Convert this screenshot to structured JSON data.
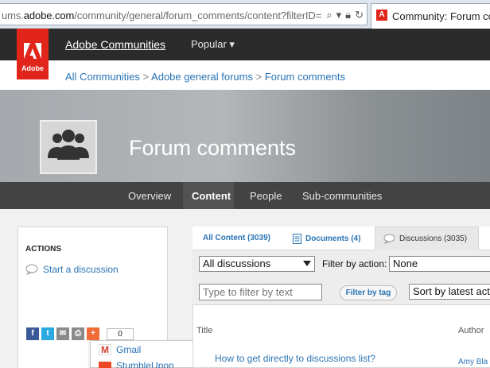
{
  "browser": {
    "url_prefix": "ums.",
    "url_domain": "adobe.com",
    "url_rest": "/community/general/forum_comments/content?filterID=",
    "tab_title": "Community: Forum com",
    "favicon_letter": "A"
  },
  "topnav": {
    "logo_text": "Adobe",
    "home_label": "Adobe Communities",
    "popular_label": "Popular ▾"
  },
  "breadcrumb": {
    "items": [
      "All Communities",
      "Adobe general forums",
      "Forum comments"
    ],
    "separator": ">"
  },
  "hero": {
    "title": "Forum comments"
  },
  "subnav": {
    "items": [
      "Overview",
      "Content",
      "People",
      "Sub-communities"
    ],
    "active": "Content"
  },
  "actions": {
    "title": "ACTIONS",
    "start_discussion": "Start a discussion",
    "share_count": "0",
    "share_buttons": [
      "facebook-icon",
      "twitter-icon",
      "email-icon",
      "print-icon",
      "share-plus-icon"
    ],
    "popup_items": [
      "Gmail",
      "StumbleUpon"
    ]
  },
  "content_tabs": [
    {
      "label": "All Content (3039)",
      "icon": ""
    },
    {
      "label": "Documents (4)",
      "icon": "document-icon"
    },
    {
      "label": "Discussions (3035)",
      "icon": "discussion-icon"
    }
  ],
  "filters": {
    "type_select": "All discussions",
    "filter_label": "Filter by action:",
    "action_select": "None",
    "text_placeholder": "Type to filter by text",
    "tag_button": "Filter by tag",
    "sort_select": "Sort by latest acti"
  },
  "table": {
    "columns": [
      "Title",
      "Author"
    ],
    "rows": [
      {
        "title": "How to get directly to discussions list?",
        "author": "Amy Bla"
      }
    ]
  },
  "colors": {
    "accent": "#2a74b5",
    "brand_red": "#e1251b",
    "nav_dark": "#2b2b2b"
  }
}
